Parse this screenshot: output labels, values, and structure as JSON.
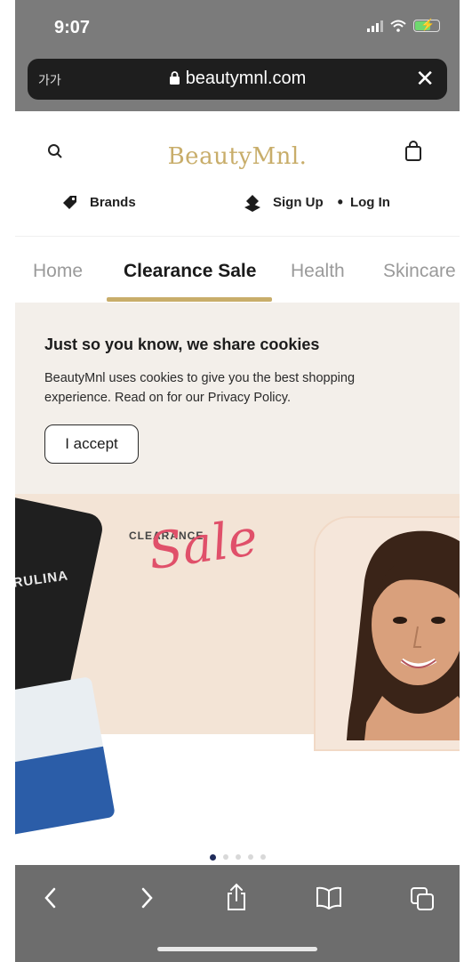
{
  "status_bar": {
    "time": "9:07"
  },
  "browser": {
    "text_size_label": "가가",
    "url": "beautymnl.com"
  },
  "header": {
    "logo": "BeautyMnl.",
    "brands_label": "Brands",
    "signup_label": "Sign Up",
    "separator": "•",
    "login_label": "Log In"
  },
  "tabs": [
    {
      "label": "Home",
      "active": false
    },
    {
      "label": "Clearance Sale",
      "active": true
    },
    {
      "label": "Health",
      "active": false
    },
    {
      "label": "Skincare",
      "active": false
    }
  ],
  "cookie_notice": {
    "title": "Just so you know, we share cookies",
    "body": "BeautyMnl uses cookies to give you the best shopping experience. Read on for our Privacy Policy.",
    "accept_label": "I accept"
  },
  "banner": {
    "small_text": "CLEARANCE",
    "script_text": "Sale",
    "bottle_label": "SPIRULINA",
    "slide_index": 1,
    "slide_count": 5
  },
  "colors": {
    "brand_gold": "#c8ad6a",
    "sale_pink": "#e0506a",
    "cookie_bg": "#f3efea"
  }
}
